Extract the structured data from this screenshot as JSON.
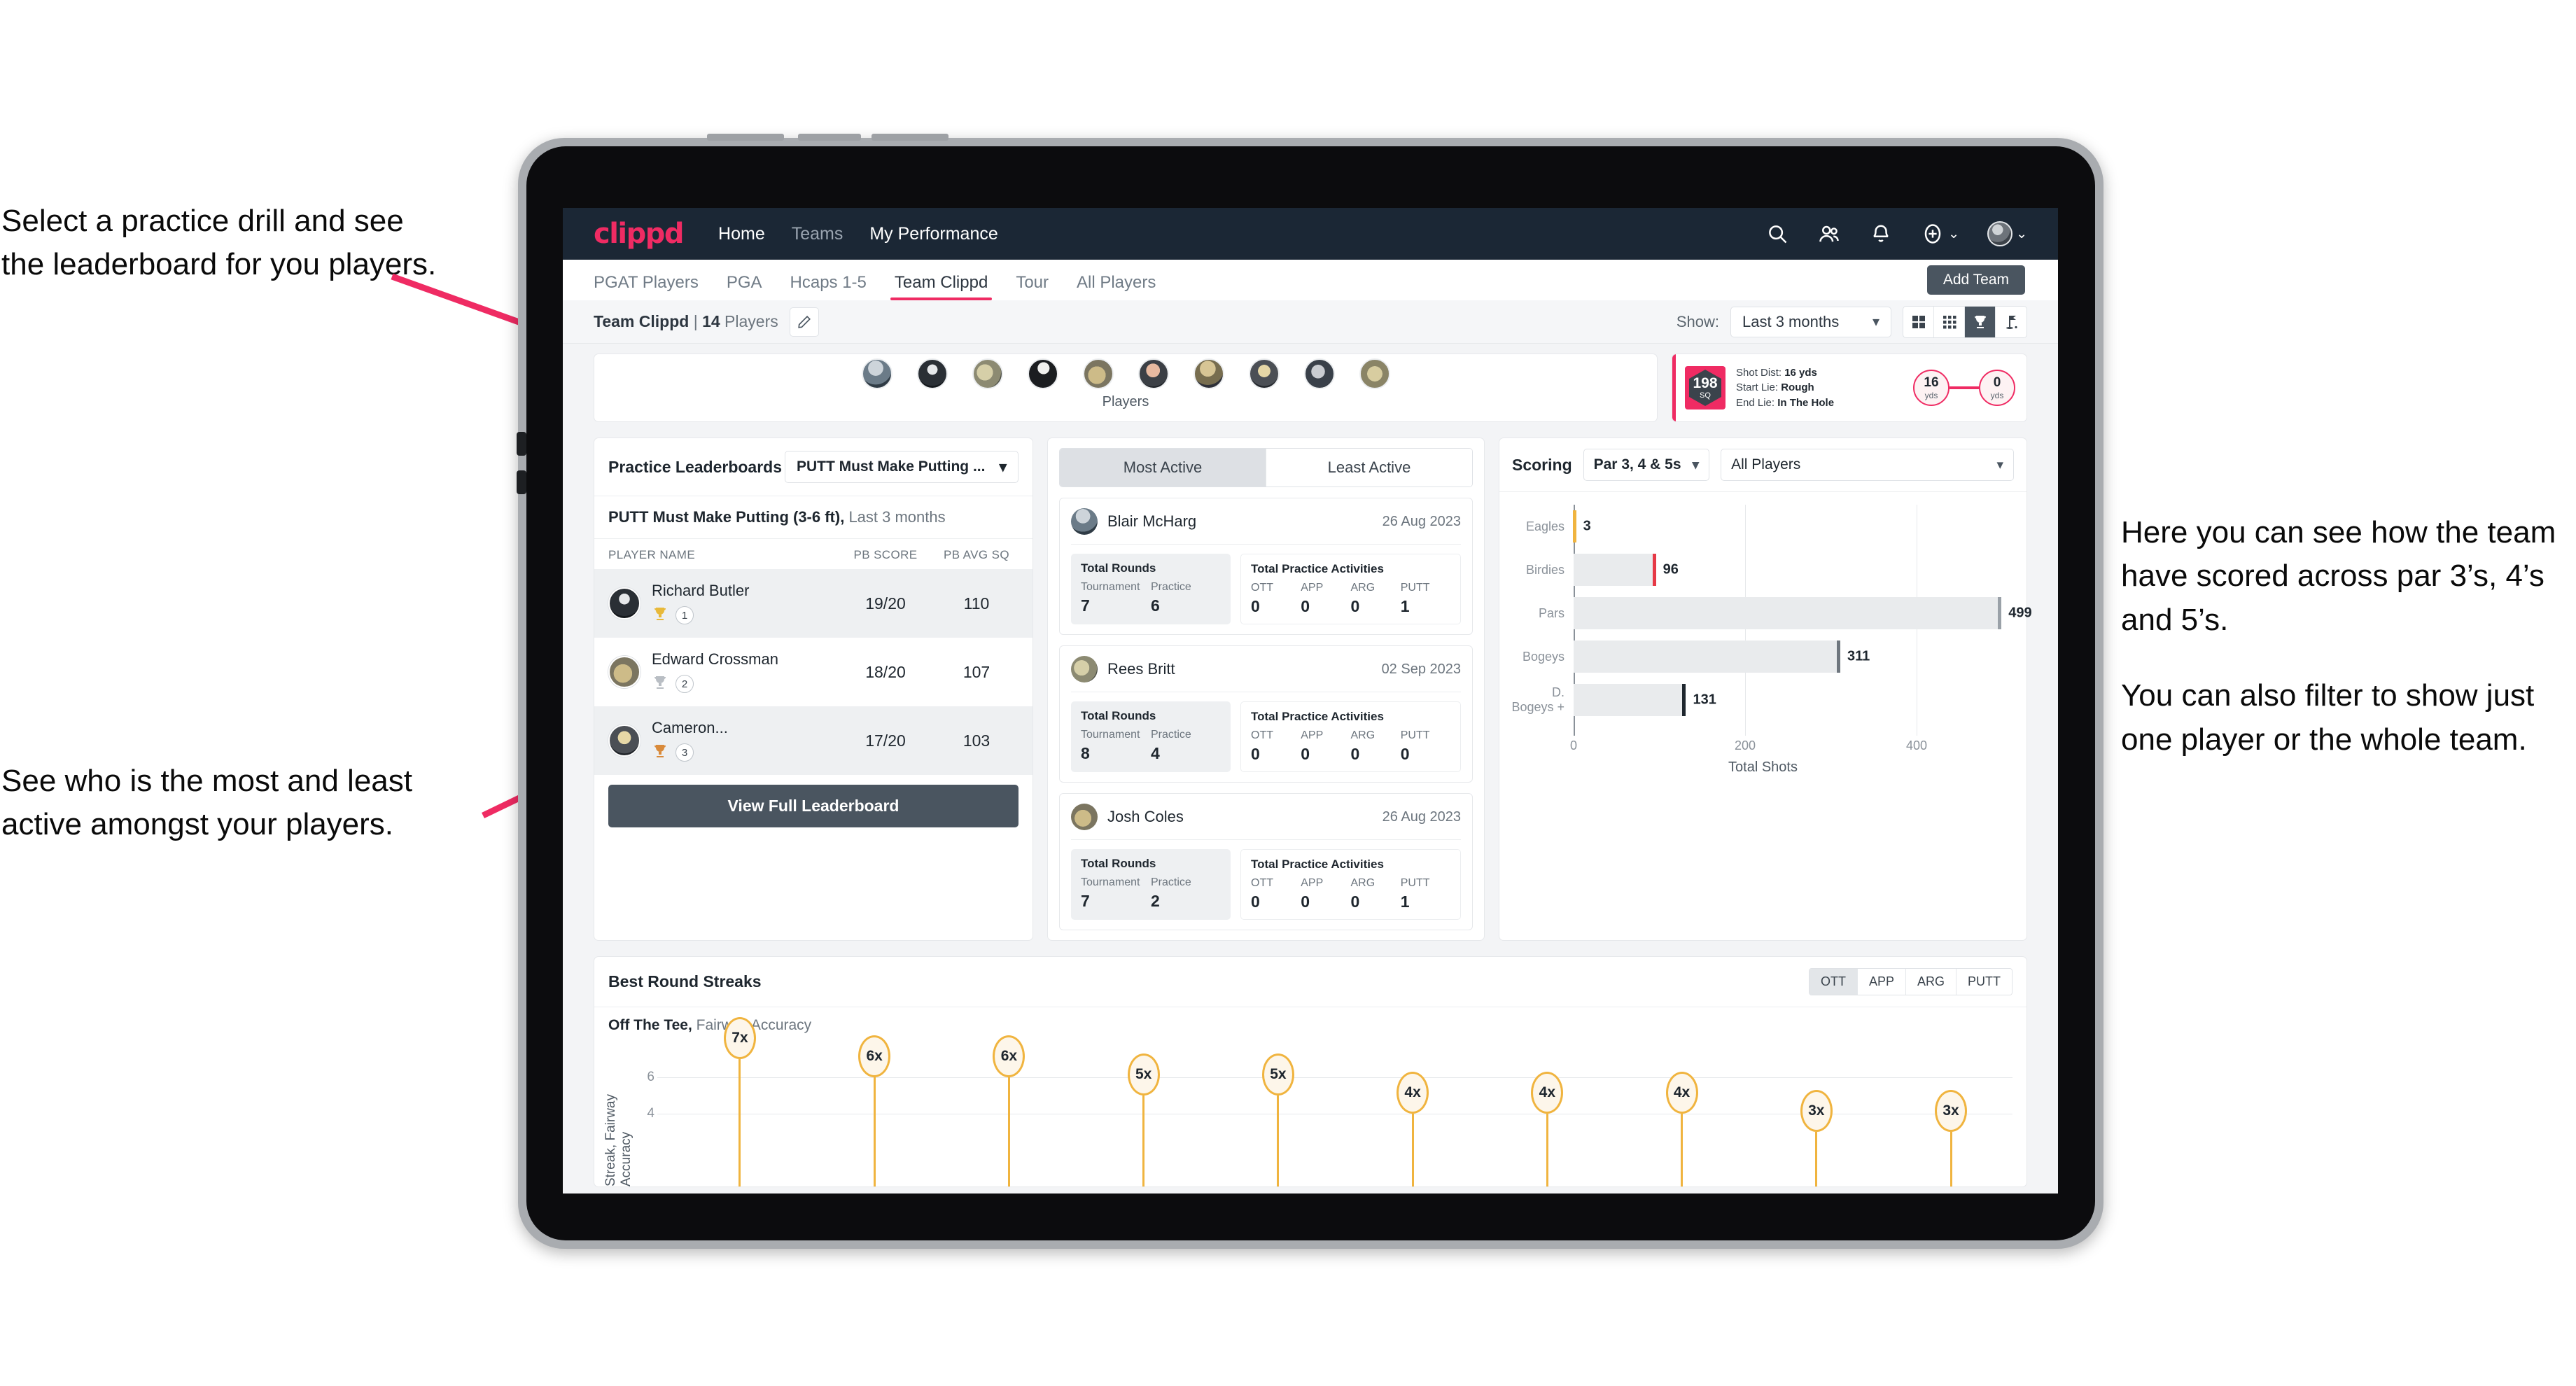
{
  "annotations": {
    "top_left": [
      "Select a practice drill and see",
      "the leaderboard for you players."
    ],
    "bottom_left": [
      "See who is the most and least",
      "active amongst your players."
    ],
    "right": [
      "Here you can see how the team have scored across par 3’s, 4’s and 5’s.",
      "You can also filter to show just one player or the whole team."
    ]
  },
  "topnav": {
    "logo": "clippd",
    "links": [
      {
        "label": "Home",
        "active": true
      },
      {
        "label": "Teams",
        "active": false
      },
      {
        "label": "My Performance",
        "active": true
      }
    ],
    "icons": [
      "search-icon",
      "people-icon",
      "bell-icon",
      "plus-circle-icon"
    ],
    "add_caret": "⌄",
    "avatar_caret": "⌄"
  },
  "tabs": [
    {
      "label": "PGAT Players",
      "active": false
    },
    {
      "label": "PGA",
      "active": false
    },
    {
      "label": "Hcaps 1-5",
      "active": false
    },
    {
      "label": "Team Clippd",
      "active": true
    },
    {
      "label": "Tour",
      "active": false
    },
    {
      "label": "All Players",
      "active": false
    }
  ],
  "add_team_button": "Add Team",
  "subheader": {
    "team_name": "Team Clippd",
    "separator": " | ",
    "player_count": "14",
    "players_word": " Players",
    "show_label": "Show:",
    "period_value": "Last 3 months",
    "view_modes": [
      "grid-large-icon",
      "grid-small-icon",
      "trophy-icon",
      "golf-flag-icon"
    ],
    "active_view": "trophy-icon"
  },
  "players_card": {
    "label": "Players",
    "avatar_count": 10
  },
  "shot_card": {
    "score_value": "198",
    "score_unit": "SQ",
    "lines": [
      {
        "label": "Shot Dist: ",
        "value": "16 yds"
      },
      {
        "label": "Start Lie: ",
        "value": "Rough"
      },
      {
        "label": "End Lie: ",
        "value": "In The Hole"
      }
    ],
    "start_dist": "16",
    "start_unit": "yds",
    "end_dist": "0",
    "end_unit": "yds"
  },
  "leaderboard": {
    "title": "Practice Leaderboards",
    "drill_select": "PUTT Must Make Putting ...",
    "subtitle_bold": "PUTT Must Make Putting (3-6 ft),",
    "subtitle_rest": " Last 3 months",
    "columns": [
      "PLAYER NAME",
      "PB SCORE",
      "PB AVG SQ"
    ],
    "rows": [
      {
        "name": "Richard Butler",
        "rank": "1",
        "trophy": "gold",
        "pb_score": "19/20",
        "pb_avg_sq": "110"
      },
      {
        "name": "Edward Crossman",
        "rank": "2",
        "trophy": "silver",
        "pb_score": "18/20",
        "pb_avg_sq": "107"
      },
      {
        "name": "Cameron...",
        "rank": "3",
        "trophy": "bronze",
        "pb_score": "17/20",
        "pb_avg_sq": "103"
      }
    ],
    "button": "View Full Leaderboard"
  },
  "activity": {
    "tabs": [
      {
        "label": "Most Active",
        "active": true
      },
      {
        "label": "Least Active",
        "active": false
      }
    ],
    "rounds_header": "Total Rounds",
    "practice_header": "Total Practice Activities",
    "rounds_keys": [
      "Tournament",
      "Practice"
    ],
    "practice_keys": [
      "OTT",
      "APP",
      "ARG",
      "PUTT"
    ],
    "players": [
      {
        "name": "Blair McHarg",
        "date": "26 Aug 2023",
        "tournament": "7",
        "practice": "6",
        "ott": "0",
        "app": "0",
        "arg": "0",
        "putt": "1"
      },
      {
        "name": "Rees Britt",
        "date": "02 Sep 2023",
        "tournament": "8",
        "practice": "4",
        "ott": "0",
        "app": "0",
        "arg": "0",
        "putt": "0"
      },
      {
        "name": "Josh Coles",
        "date": "26 Aug 2023",
        "tournament": "7",
        "practice": "2",
        "ott": "0",
        "app": "0",
        "arg": "0",
        "putt": "1"
      }
    ]
  },
  "scoring": {
    "title": "Scoring",
    "par_filter": "Par 3, 4 & 5s",
    "player_filter": "All Players"
  },
  "streaks": {
    "title": "Best Round Streaks",
    "metric_tabs": [
      {
        "label": "OTT",
        "active": true
      },
      {
        "label": "APP",
        "active": false
      },
      {
        "label": "ARG",
        "active": false
      },
      {
        "label": "PUTT",
        "active": false
      }
    ],
    "subtitle_bold": "Off The Tee,",
    "subtitle_rest": " Fairway Accuracy"
  },
  "colors": {
    "brand_pink": "#ef2b63",
    "nav_dark": "#1b2735",
    "slate": "#4a5560",
    "gold": "#f0b43f",
    "bar_grey": "#e9ebed"
  },
  "chart_data": [
    {
      "type": "bar",
      "orientation": "horizontal",
      "title": "Scoring",
      "categories": [
        "Eagles",
        "Birdies",
        "Pars",
        "Bogeys",
        "D. Bogeys +"
      ],
      "values": [
        3,
        96,
        499,
        311,
        131
      ],
      "cap_colors": [
        "#f0b43f",
        "#e63946",
        "#9aa1a8",
        "#6e767e",
        "#1e262e"
      ],
      "xlabel": "Total Shots",
      "ylabel": "",
      "xlim": [
        0,
        520
      ],
      "xticks": [
        0,
        200,
        400
      ],
      "grid": true,
      "legend": "none"
    },
    {
      "type": "scatter",
      "title": "Best Round Streaks",
      "subtitle": "Off The Tee, Fairway Accuracy",
      "ylabel": "Streak, Fairway Accuracy",
      "xlabel": "",
      "values": [
        7,
        6,
        6,
        5,
        5,
        4,
        4,
        4,
        3,
        3
      ],
      "labels": [
        "7x",
        "6x",
        "6x",
        "5x",
        "5x",
        "4x",
        "4x",
        "4x",
        "3x",
        "3x"
      ],
      "yticks": [
        4,
        6
      ],
      "ylim": [
        0,
        8
      ],
      "grid": true,
      "marker_color": "#f0b43f"
    }
  ]
}
